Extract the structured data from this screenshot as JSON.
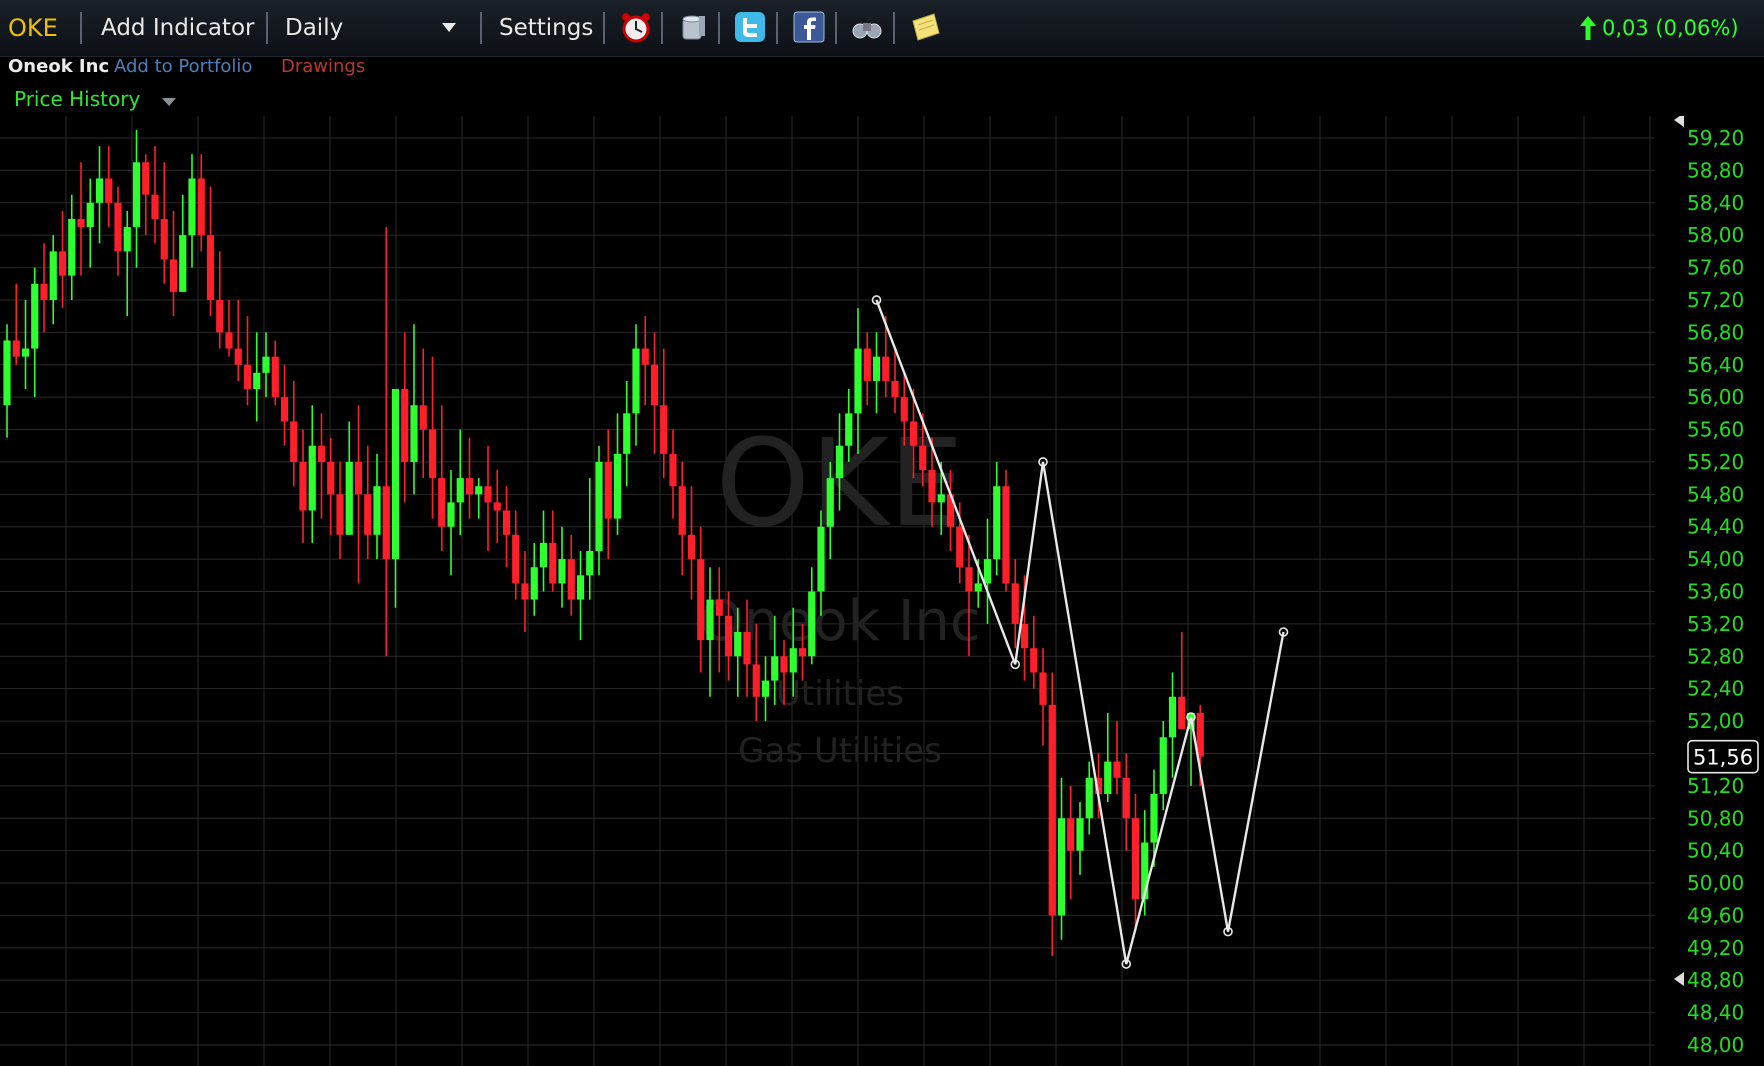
{
  "toolbar": {
    "symbol": "OKE",
    "add_indicator": "Add Indicator",
    "interval": "Daily",
    "settings": "Settings",
    "change": "0,03 (0,06%)",
    "icons": [
      "alarm-clock-icon",
      "database-icon",
      "twitter-icon",
      "facebook-icon",
      "binoculars-icon",
      "note-icon"
    ]
  },
  "subbar": {
    "company": "Oneok Inc",
    "add_portfolio": "Add to Portfolio",
    "drawings": "Drawings",
    "panel": "Price History"
  },
  "watermark": {
    "symbol": "OKE",
    "company": "Oneok Inc",
    "sector": "Utilities",
    "industry": "Gas Utilities"
  },
  "colors": {
    "up": "#2eff2e",
    "down": "#ff1f2a",
    "axis_text": "#22dd22",
    "accent": "#f0c000",
    "drawing": "#e8e8e8"
  },
  "chart_data": {
    "type": "candlestick",
    "yaxis_ticks": [
      "59,20",
      "58,80",
      "58,40",
      "58,00",
      "57,60",
      "57,20",
      "56,80",
      "56,40",
      "56,00",
      "55,60",
      "55,20",
      "54,80",
      "54,40",
      "54,00",
      "53,60",
      "53,20",
      "52,80",
      "52,40",
      "52,00",
      "51,20",
      "50,80",
      "50,40",
      "50,00",
      "49,60",
      "49,20",
      "48,80",
      "48,40",
      "48,00"
    ],
    "ylim": [
      48.0,
      59.2
    ],
    "last_price_label": "51,56",
    "last_price": 51.56,
    "candles": [
      [
        55.9,
        56.9,
        55.5,
        56.7
      ],
      [
        56.7,
        57.4,
        56.4,
        56.5
      ],
      [
        56.5,
        57.2,
        56.1,
        56.6
      ],
      [
        56.6,
        57.6,
        56.0,
        57.4
      ],
      [
        57.4,
        57.9,
        56.8,
        57.2
      ],
      [
        57.2,
        58.0,
        56.9,
        57.8
      ],
      [
        57.8,
        58.3,
        57.1,
        57.5
      ],
      [
        57.5,
        58.5,
        57.2,
        58.2
      ],
      [
        58.2,
        58.9,
        57.5,
        58.1
      ],
      [
        58.1,
        58.7,
        57.6,
        58.4
      ],
      [
        58.4,
        59.1,
        57.9,
        58.7
      ],
      [
        58.7,
        59.1,
        58.1,
        58.4
      ],
      [
        58.4,
        58.6,
        57.5,
        57.8
      ],
      [
        57.8,
        58.3,
        57.0,
        58.1
      ],
      [
        58.1,
        59.3,
        57.6,
        58.9
      ],
      [
        58.9,
        59.0,
        58.0,
        58.5
      ],
      [
        58.5,
        59.1,
        57.9,
        58.2
      ],
      [
        58.2,
        58.9,
        57.4,
        57.7
      ],
      [
        57.7,
        58.3,
        57.0,
        57.3
      ],
      [
        57.3,
        58.5,
        57.3,
        58.0
      ],
      [
        58.0,
        59.0,
        57.6,
        58.7
      ],
      [
        58.7,
        59.0,
        57.8,
        58.0
      ],
      [
        58.0,
        58.6,
        57.0,
        57.2
      ],
      [
        57.2,
        57.8,
        56.6,
        56.8
      ],
      [
        56.8,
        57.2,
        56.5,
        56.6
      ],
      [
        56.6,
        57.2,
        56.2,
        56.4
      ],
      [
        56.4,
        57.0,
        55.9,
        56.1
      ],
      [
        56.1,
        56.8,
        55.7,
        56.3
      ],
      [
        56.3,
        56.8,
        56.0,
        56.5
      ],
      [
        56.5,
        56.7,
        55.9,
        56.0
      ],
      [
        56.0,
        56.4,
        55.4,
        55.7
      ],
      [
        55.7,
        56.2,
        54.9,
        55.2
      ],
      [
        55.2,
        55.6,
        54.2,
        54.6
      ],
      [
        54.6,
        55.9,
        54.2,
        55.4
      ],
      [
        55.4,
        55.8,
        54.5,
        55.2
      ],
      [
        55.2,
        55.5,
        54.3,
        54.8
      ],
      [
        54.8,
        55.2,
        54.0,
        54.3
      ],
      [
        54.3,
        55.7,
        54.3,
        55.2
      ],
      [
        55.2,
        55.9,
        53.7,
        54.8
      ],
      [
        54.8,
        55.4,
        54.0,
        54.3
      ],
      [
        54.3,
        55.3,
        54.0,
        54.9
      ],
      [
        54.9,
        58.1,
        52.8,
        54.0
      ],
      [
        54.0,
        56.1,
        53.4,
        56.1
      ],
      [
        56.1,
        56.8,
        54.7,
        55.2
      ],
      [
        55.2,
        56.9,
        54.8,
        55.9
      ],
      [
        55.9,
        56.6,
        55.0,
        55.6
      ],
      [
        55.6,
        56.5,
        54.5,
        55.0
      ],
      [
        55.0,
        55.9,
        54.1,
        54.4
      ],
      [
        54.4,
        55.1,
        53.8,
        54.7
      ],
      [
        54.7,
        55.6,
        54.3,
        55.0
      ],
      [
        55.0,
        55.5,
        54.5,
        54.8
      ],
      [
        54.8,
        55.0,
        54.5,
        54.9
      ],
      [
        54.9,
        55.4,
        54.1,
        54.7
      ],
      [
        54.7,
        55.1,
        54.2,
        54.6
      ],
      [
        54.6,
        54.9,
        53.9,
        54.3
      ],
      [
        54.3,
        54.6,
        53.5,
        53.7
      ],
      [
        53.7,
        54.1,
        53.1,
        53.5
      ],
      [
        53.5,
        54.2,
        53.3,
        53.9
      ],
      [
        53.9,
        54.6,
        53.6,
        54.2
      ],
      [
        54.2,
        54.6,
        53.6,
        53.7
      ],
      [
        53.7,
        54.4,
        53.4,
        54.0
      ],
      [
        54.0,
        54.3,
        53.3,
        53.5
      ],
      [
        53.5,
        54.1,
        53.0,
        53.8
      ],
      [
        53.8,
        55.0,
        53.5,
        54.1
      ],
      [
        54.1,
        55.4,
        53.8,
        55.2
      ],
      [
        55.2,
        55.6,
        54.0,
        54.5
      ],
      [
        54.5,
        55.8,
        54.3,
        55.3
      ],
      [
        55.3,
        56.2,
        54.9,
        55.8
      ],
      [
        55.8,
        56.9,
        55.4,
        56.6
      ],
      [
        56.6,
        57.0,
        55.9,
        56.4
      ],
      [
        56.4,
        56.8,
        55.3,
        55.9
      ],
      [
        55.9,
        56.6,
        55.0,
        55.3
      ],
      [
        55.3,
        55.6,
        54.5,
        54.9
      ],
      [
        54.9,
        55.2,
        53.8,
        54.3
      ],
      [
        54.3,
        54.9,
        53.5,
        54.0
      ],
      [
        54.0,
        54.4,
        52.6,
        53.0
      ],
      [
        53.0,
        53.9,
        52.3,
        53.5
      ],
      [
        53.5,
        53.9,
        52.6,
        53.3
      ],
      [
        53.3,
        53.6,
        52.5,
        52.8
      ],
      [
        52.8,
        53.4,
        52.3,
        53.1
      ],
      [
        53.1,
        53.5,
        52.3,
        52.7
      ],
      [
        52.7,
        53.2,
        52.0,
        52.3
      ],
      [
        52.3,
        52.8,
        52.0,
        52.5
      ],
      [
        52.5,
        53.3,
        52.2,
        52.8
      ],
      [
        52.8,
        53.0,
        52.2,
        52.6
      ],
      [
        52.6,
        53.4,
        52.3,
        52.9
      ],
      [
        52.9,
        53.2,
        52.5,
        52.8
      ],
      [
        52.8,
        53.9,
        52.7,
        53.6
      ],
      [
        53.6,
        54.6,
        53.3,
        54.4
      ],
      [
        54.4,
        55.2,
        54.0,
        55.0
      ],
      [
        55.0,
        55.8,
        54.6,
        55.4
      ],
      [
        55.4,
        56.1,
        55.2,
        55.8
      ],
      [
        55.8,
        57.1,
        55.3,
        56.6
      ],
      [
        56.6,
        56.8,
        55.9,
        56.2
      ],
      [
        56.2,
        56.8,
        55.8,
        56.5
      ],
      [
        56.5,
        57.0,
        56.0,
        56.2
      ],
      [
        56.2,
        56.6,
        55.8,
        56.0
      ],
      [
        56.0,
        56.3,
        55.4,
        55.7
      ],
      [
        55.7,
        56.1,
        55.0,
        55.4
      ],
      [
        55.4,
        55.8,
        54.9,
        55.1
      ],
      [
        55.1,
        55.5,
        54.4,
        54.7
      ],
      [
        54.7,
        55.2,
        54.3,
        54.8
      ],
      [
        54.8,
        55.1,
        54.1,
        54.4
      ],
      [
        54.4,
        54.7,
        53.7,
        53.9
      ],
      [
        53.9,
        54.3,
        52.8,
        53.6
      ],
      [
        53.6,
        54.0,
        53.4,
        53.7
      ],
      [
        53.7,
        54.5,
        53.2,
        54.0
      ],
      [
        54.0,
        55.2,
        53.8,
        54.9
      ],
      [
        54.9,
        55.1,
        53.6,
        53.7
      ],
      [
        53.7,
        54.0,
        52.9,
        53.2
      ],
      [
        53.2,
        53.8,
        52.5,
        52.9
      ],
      [
        52.9,
        53.3,
        52.4,
        52.6
      ],
      [
        52.6,
        52.9,
        51.7,
        52.2
      ],
      [
        52.2,
        52.6,
        49.1,
        49.6
      ],
      [
        49.6,
        51.3,
        49.3,
        50.8
      ],
      [
        50.8,
        51.2,
        49.8,
        50.4
      ],
      [
        50.4,
        51.0,
        50.1,
        50.8
      ],
      [
        50.8,
        51.5,
        50.6,
        51.3
      ],
      [
        51.3,
        51.6,
        50.8,
        51.1
      ],
      [
        51.1,
        52.1,
        51.0,
        51.5
      ],
      [
        51.5,
        52.0,
        51.1,
        51.3
      ],
      [
        51.3,
        51.6,
        50.4,
        50.8
      ],
      [
        50.8,
        51.1,
        49.4,
        49.8
      ],
      [
        49.8,
        50.9,
        49.6,
        50.5
      ],
      [
        50.5,
        51.4,
        50.2,
        51.1
      ],
      [
        51.1,
        52.0,
        50.9,
        51.8
      ],
      [
        51.8,
        52.6,
        51.3,
        52.3
      ],
      [
        52.3,
        53.1,
        51.9,
        51.9
      ],
      [
        51.9,
        52.1,
        51.2,
        52.1
      ],
      [
        52.1,
        52.2,
        51.2,
        51.56
      ]
    ],
    "drawing_points": [
      [
        94,
        57.2
      ],
      [
        109,
        52.7
      ],
      [
        112,
        55.2
      ],
      [
        121,
        49.0
      ],
      [
        128,
        52.05
      ],
      [
        132,
        49.4
      ],
      [
        138,
        53.1
      ]
    ]
  }
}
